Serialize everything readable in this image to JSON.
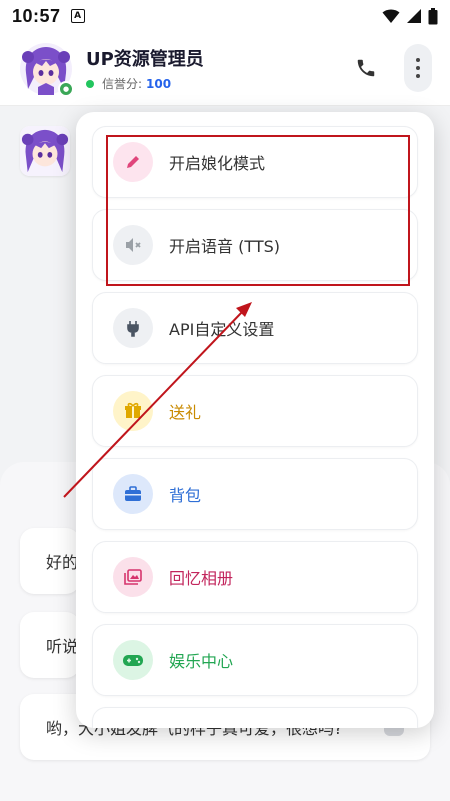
{
  "status_bar": {
    "time": "10:57",
    "notif_letter": "A"
  },
  "header": {
    "title": "UP资源管理员",
    "credit_label": "信誉分:",
    "credit_value": "100"
  },
  "menu": {
    "items": [
      {
        "label": "开启娘化模式",
        "icon": "pencil-icon",
        "color": "#e0457b",
        "bg": "#fde4ee",
        "text_color": "#333333"
      },
      {
        "label": "开启语音 (TTS)",
        "icon": "mute-icon",
        "color": "#9aa0a6",
        "bg": "#eef0f3",
        "text_color": "#333333"
      },
      {
        "label": "API自定义设置",
        "icon": "plug-icon",
        "color": "#4b5563",
        "bg": "#eef0f3",
        "text_color": "#333333"
      },
      {
        "label": "送礼",
        "icon": "gift-icon",
        "color": "#e0a800",
        "bg": "#fff4c9",
        "text_color": "#c98a00"
      },
      {
        "label": "背包",
        "icon": "briefcase-icon",
        "color": "#2f6fd6",
        "bg": "#dde8fb",
        "text_color": "#2f6fd6"
      },
      {
        "label": "回忆相册",
        "icon": "album-icon",
        "color": "#d6336c",
        "bg": "#fbe0ea",
        "text_color": "#c2255c"
      },
      {
        "label": "娱乐中心",
        "icon": "gamepad-icon",
        "color": "#22a652",
        "bg": "#dcf5e4",
        "text_color": "#22a652"
      }
    ]
  },
  "suggestions": [
    {
      "text": "好的"
    },
    {
      "text": "听说"
    },
    {
      "text": "哟，大小姐发脾气的样子真可爱，很想吗?"
    }
  ],
  "annotation_color": "#c0151c"
}
